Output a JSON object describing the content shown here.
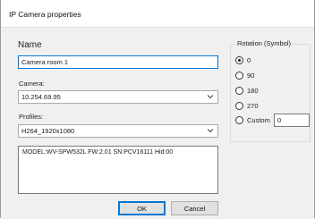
{
  "window": {
    "title": "IP Camera properties"
  },
  "name": {
    "label": "Name",
    "value": "Camera room 1"
  },
  "camera": {
    "label": "Camera:",
    "value": "10.254.69.95"
  },
  "profiles": {
    "label": "Profiles:",
    "value": "H264_1920x1080"
  },
  "info": {
    "text": "MODEL:WV-SPW532L FW:2.01 SN:PCV16111 Hid:00"
  },
  "rotation": {
    "title": "Rotation (Symbol)",
    "options": [
      "0",
      "90",
      "180",
      "270",
      "Custom"
    ],
    "selected": "0",
    "custom_value": "0"
  },
  "buttons": {
    "ok": "OK",
    "cancel": "Cancel"
  },
  "icons": {
    "dropdown": "chevron-down-icon"
  }
}
